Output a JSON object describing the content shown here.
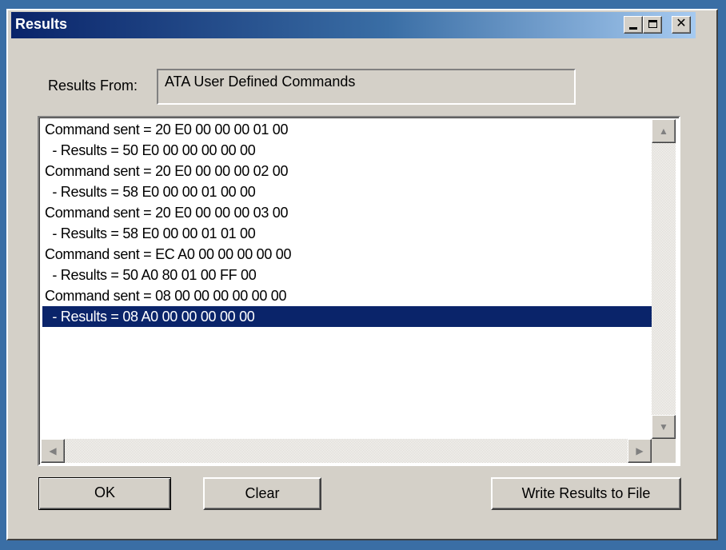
{
  "window": {
    "title": "Results",
    "minimize_glyph": "_",
    "maximize_glyph": "□",
    "close_glyph": "✕"
  },
  "results_from": {
    "label": "Results From:",
    "value": "ATA User Defined Commands"
  },
  "list": {
    "lines": [
      "Command sent = 20 E0 00 00 00 01 00",
      "  - Results = 50 E0 00 00 00 00 00",
      "Command sent = 20 E0 00 00 00 02 00",
      "  - Results = 58 E0 00 00 01 00 00",
      "Command sent = 20 E0 00 00 00 03 00",
      "  - Results = 58 E0 00 00 01 01 00",
      "Command sent = EC A0 00 00 00 00 00",
      "  - Results = 50 A0 80 01 00 FF 00",
      "Command sent = 08 00 00 00 00 00 00",
      "  - Results = 08 A0 00 00 00 00 00"
    ],
    "selected_index": 9
  },
  "scrollbar": {
    "up_glyph": "▲",
    "down_glyph": "▼",
    "left_glyph": "◀",
    "right_glyph": "▶"
  },
  "buttons": {
    "ok": "OK",
    "clear": "Clear",
    "write": "Write Results to File"
  },
  "colors": {
    "desktop": "#3a6ea5",
    "title_gradient_start": "#0a246a",
    "title_gradient_end": "#a6caf0",
    "face": "#d4d0c8",
    "selection": "#0a246a"
  }
}
